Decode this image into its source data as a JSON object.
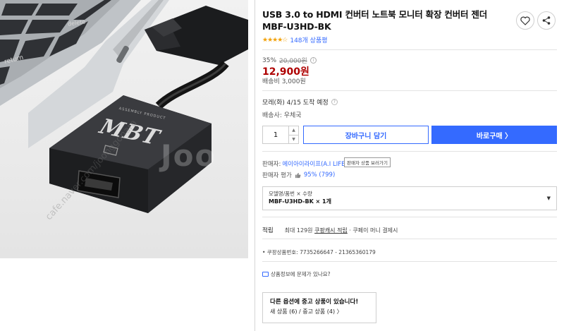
{
  "product": {
    "title": "USB 3.0 to HDMI 컨버터 노트북 모니터 확장 컨버터 젠더 MBF-U3HD-BK",
    "rating_stars": "★★★★☆",
    "review_count": "148개 상품평",
    "brand_print": "MBT",
    "brand_small_print": "ASSEMBLY PRODUCT",
    "keyboard_key_delete": "delete",
    "keyboard_key_return": "return",
    "watermark_text": "cafe.naver.com/joonggonara",
    "watermark_logo": "Joo"
  },
  "price": {
    "discount_rate": "35%",
    "original": "20,000원",
    "current": "12,900원",
    "shipping_fee": "배송비 3,000원",
    "accent_color": "#ae0000"
  },
  "delivery": {
    "eta": "모레(화) 4/15 도착 예정",
    "carrier": "배송사: 우체국"
  },
  "actions": {
    "quantity": "1",
    "cart_label": "장바구니 담기",
    "buy_label": "바로구매 〉",
    "primary_color": "#346aff"
  },
  "seller": {
    "label": "판매자:",
    "name": "에이아이라이프(A.I LIFE)",
    "popup": "판매자 상품 보러가기",
    "rating_label": "판매자 평가",
    "rating_value": "95% (799)",
    "thumb_icon": "thumbs-up-icon"
  },
  "option": {
    "label": "모델명/품번 × 수량",
    "selected": "MBF-U3HD-BK × 1개"
  },
  "cashback": {
    "label": "적립",
    "detail_prefix": "최대 129원",
    "detail_link": "쿠팡캐시 적립",
    "detail_suffix": "· 쿠페이 머니 결제시"
  },
  "product_id": "• 쿠팡상품번호: 7735266647 - 21365360179",
  "report_text": "상품정보에 문제가 있나요?",
  "other_options": {
    "title": "다른 옵션에 중고 상품이 있습니다!",
    "link": "새 상품 (6) / 중고 상품 (4) 〉"
  }
}
